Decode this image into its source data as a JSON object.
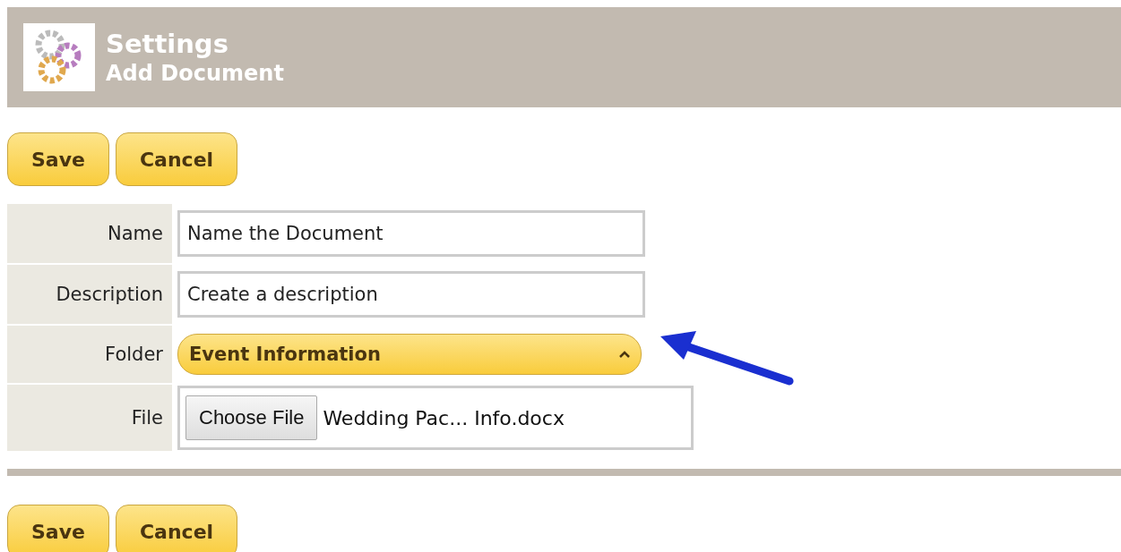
{
  "header": {
    "title": "Settings",
    "subtitle": "Add Document"
  },
  "top_buttons": [
    "Save",
    "Cancel"
  ],
  "form": [
    {
      "kind": "text",
      "label": "Name",
      "value": "Name the Document"
    },
    {
      "kind": "text",
      "label": "Description",
      "value": "Create a description"
    },
    {
      "kind": "select",
      "label": "Folder",
      "value": "Event Information",
      "expanded": true
    },
    {
      "kind": "file",
      "label": "File",
      "button": "Choose File",
      "value": "Wedding Pac... Info.docx"
    }
  ],
  "bottom_buttons": [
    "Save",
    "Cancel"
  ]
}
